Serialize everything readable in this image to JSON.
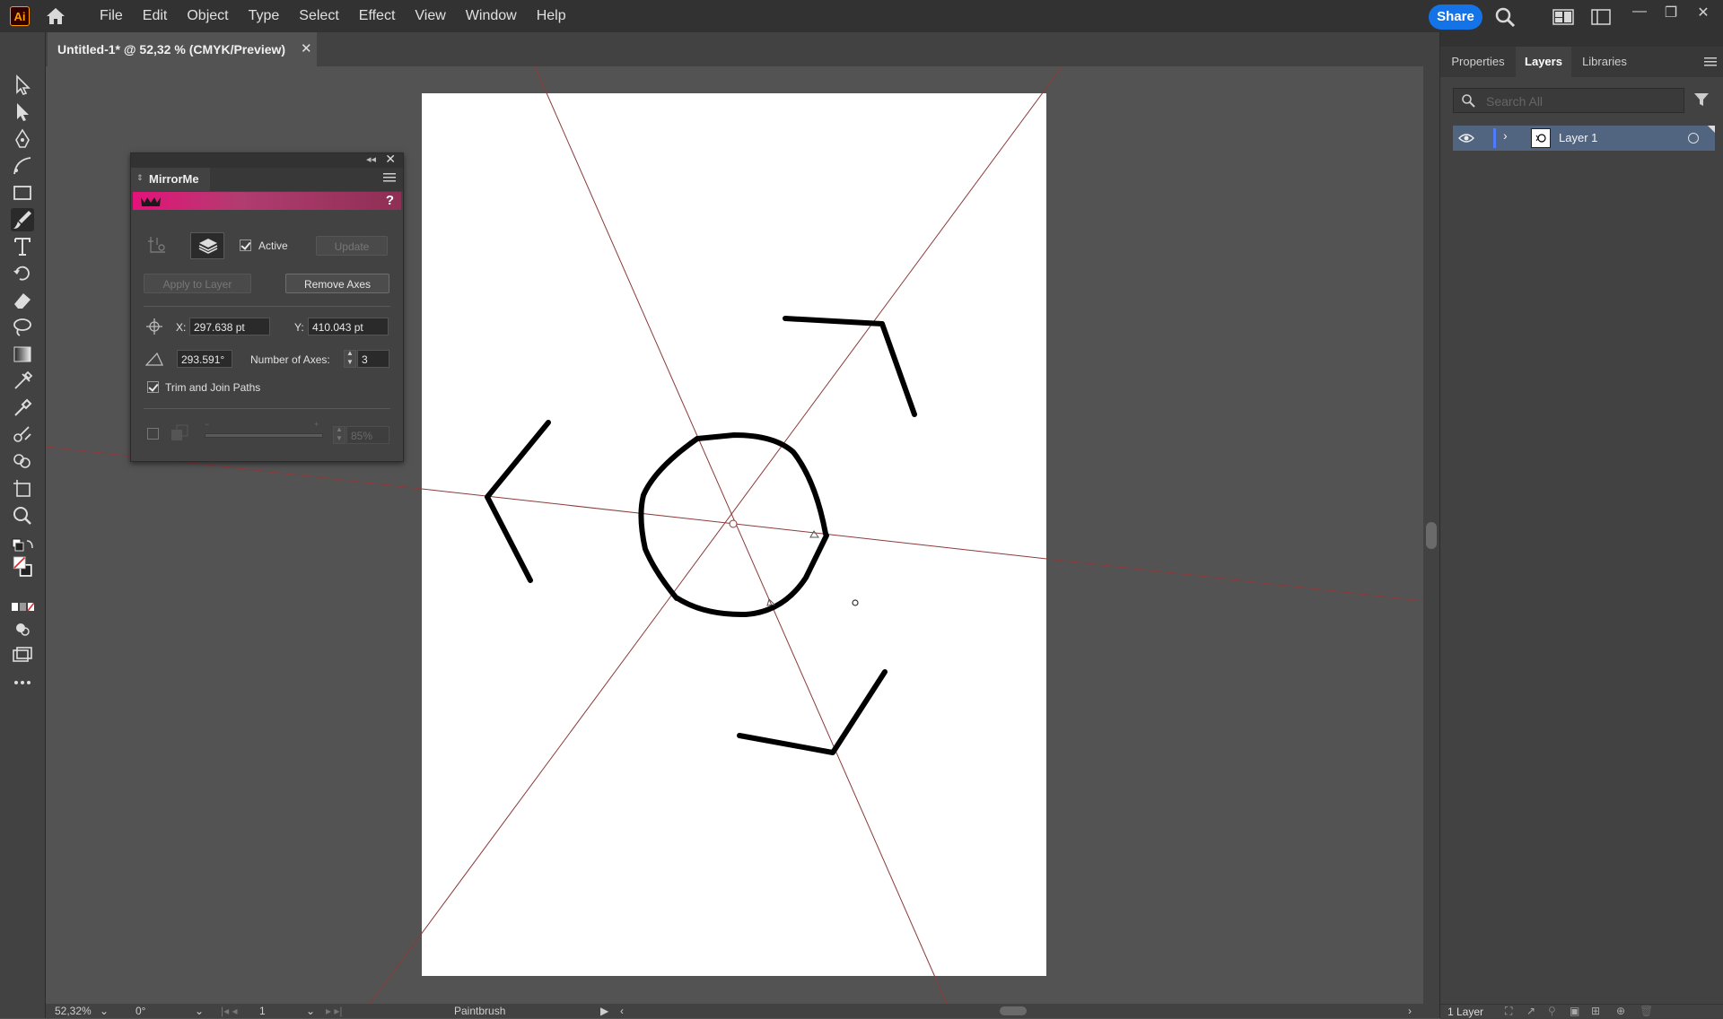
{
  "app": {
    "logo_text": "Ai",
    "menus": [
      "File",
      "Edit",
      "Object",
      "Type",
      "Select",
      "Effect",
      "View",
      "Window",
      "Help"
    ],
    "share_label": "Share",
    "window_controls": {
      "minimize": "—",
      "restore": "❐",
      "close": "✕"
    }
  },
  "document": {
    "tab_title": "Untitled-1* @ 52,32 % (CMYK/Preview)",
    "close_glyph": "✕"
  },
  "mirrorme": {
    "title": "MirrorMe",
    "collapse_glyph": "◂◂",
    "close_glyph": "✕",
    "help": "?",
    "active_label": "Active",
    "active_checked": true,
    "update_label": "Update",
    "apply_label": "Apply to Layer",
    "remove_label": "Remove Axes",
    "x_label": "X:",
    "x_value": "297.638 pt",
    "y_label": "Y:",
    "y_value": "410.043 pt",
    "angle_value": "293.591°",
    "axes_label": "Number of Axes:",
    "axes_value": "3",
    "trim_label": "Trim and Join Paths",
    "trim_checked": true,
    "opacity_value": "85%"
  },
  "status": {
    "zoom": "52,32%",
    "rotation": "0°",
    "artboard_num": "1",
    "tool": "Paintbrush"
  },
  "right_panel": {
    "tabs": [
      "Properties",
      "Layers",
      "Libraries"
    ],
    "active_tab": "Layers",
    "search_placeholder": "Search All",
    "layers": [
      {
        "name": "Layer 1"
      }
    ],
    "layer_count": "1 Layer"
  },
  "colors": {
    "accent": "#1473e6",
    "banner": "#e4127a",
    "axis_line": "#8b3a3a",
    "layer_color": "#4f7cff",
    "layer_row": "#526580"
  }
}
